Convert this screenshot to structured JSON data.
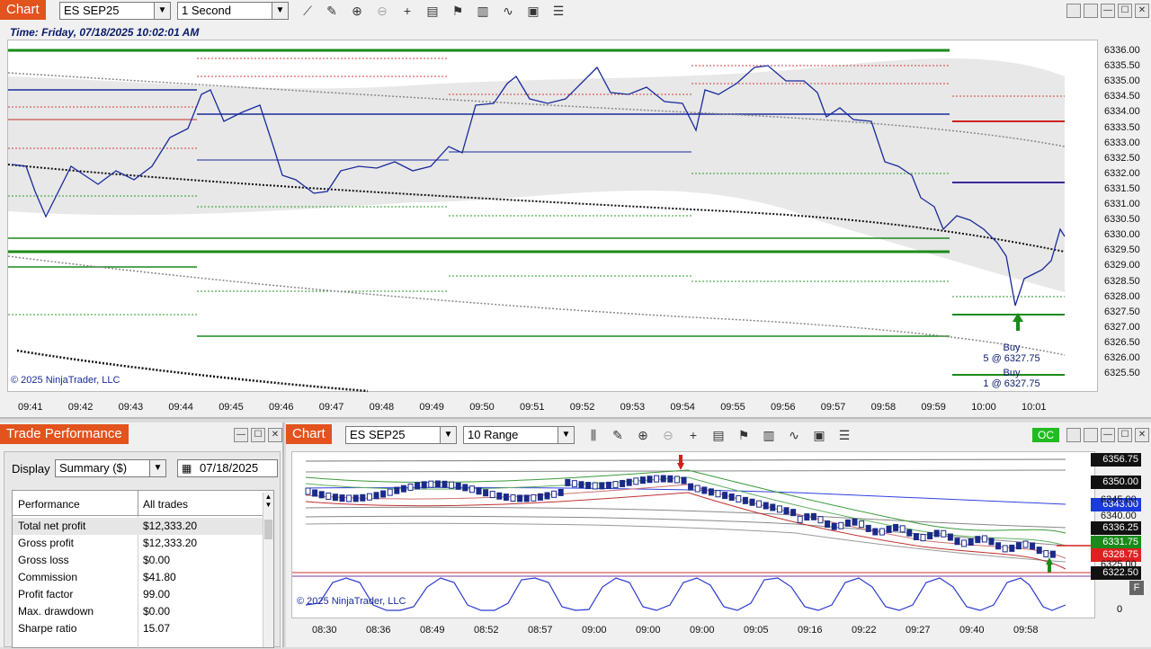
{
  "top_chart": {
    "tab": "Chart",
    "instrument": "ES SEP25",
    "interval": "1 Second",
    "time_header": "Time: Friday, 07/18/2025 10:02:01 AM",
    "copyright": "© 2025 NinjaTrader, LLC",
    "price_labels": [
      "6336.00",
      "6335.50",
      "6335.00",
      "6334.50",
      "6334.00",
      "6333.50",
      "6333.00",
      "6332.50",
      "6332.00",
      "6331.50",
      "6331.00",
      "6330.50",
      "6330.00",
      "6329.50",
      "6329.00",
      "6328.50",
      "6328.00",
      "6327.50",
      "6327.00",
      "6326.50",
      "6326.00",
      "6325.50"
    ],
    "time_labels": [
      "09:41",
      "09:42",
      "09:43",
      "09:44",
      "09:45",
      "09:46",
      "09:47",
      "09:48",
      "09:49",
      "09:50",
      "09:51",
      "09:52",
      "09:53",
      "09:54",
      "09:55",
      "09:56",
      "09:57",
      "09:58",
      "09:59",
      "10:00",
      "10:01"
    ],
    "annotations": [
      {
        "label": "Buy",
        "detail": "5 @ 6327.75"
      },
      {
        "label": "Buy",
        "detail": "1 @ 6327.75"
      }
    ],
    "colors": {
      "price": "#1a2a9a",
      "red_line": "#d02020",
      "green_line": "#1a8a1a",
      "band": "#e6e6e6"
    }
  },
  "trade_performance": {
    "tab": "Trade Performance",
    "display_label": "Display",
    "display_value": "Summary ($)",
    "date": "07/18/2025",
    "col_performance": "Performance",
    "col_all": "All trades",
    "rows": [
      {
        "name": "Total net profit",
        "value": "$12,333.20"
      },
      {
        "name": "Gross profit",
        "value": "$12,333.20"
      },
      {
        "name": "Gross loss",
        "value": "$0.00"
      },
      {
        "name": "Commission",
        "value": "$41.80"
      },
      {
        "name": "Profit factor",
        "value": "99.00"
      },
      {
        "name": "Max. drawdown",
        "value": "$0.00"
      },
      {
        "name": "Sharpe ratio",
        "value": "15.07"
      }
    ]
  },
  "bottom_chart": {
    "tab": "Chart",
    "instrument": "ES SEP25",
    "interval": "10 Range",
    "oc_badge": "OC",
    "copyright": "© 2025 NinjaTrader, LLC",
    "indicator_button": "F",
    "price_tags": [
      {
        "text": "6356.75",
        "color": "#111111"
      },
      {
        "text": "6350.00",
        "color": "#111111"
      },
      {
        "text": "6343.00",
        "color": "#1a3adc"
      },
      {
        "text": "6336.25",
        "color": "#111111"
      },
      {
        "text": "6331.75",
        "color": "#1a8a1a"
      },
      {
        "text": "6328.75",
        "color": "#e02020"
      },
      {
        "text": "6322.50",
        "color": "#111111"
      }
    ],
    "hidden_labels": [
      "6345.00",
      "6340.00",
      "6325.00"
    ],
    "osc_zero": "0",
    "time_labels": [
      "08:30",
      "08:36",
      "08:49",
      "08:52",
      "08:57",
      "09:00",
      "09:00",
      "09:00",
      "09:05",
      "09:16",
      "09:22",
      "09:27",
      "09:40",
      "09:58"
    ]
  }
}
